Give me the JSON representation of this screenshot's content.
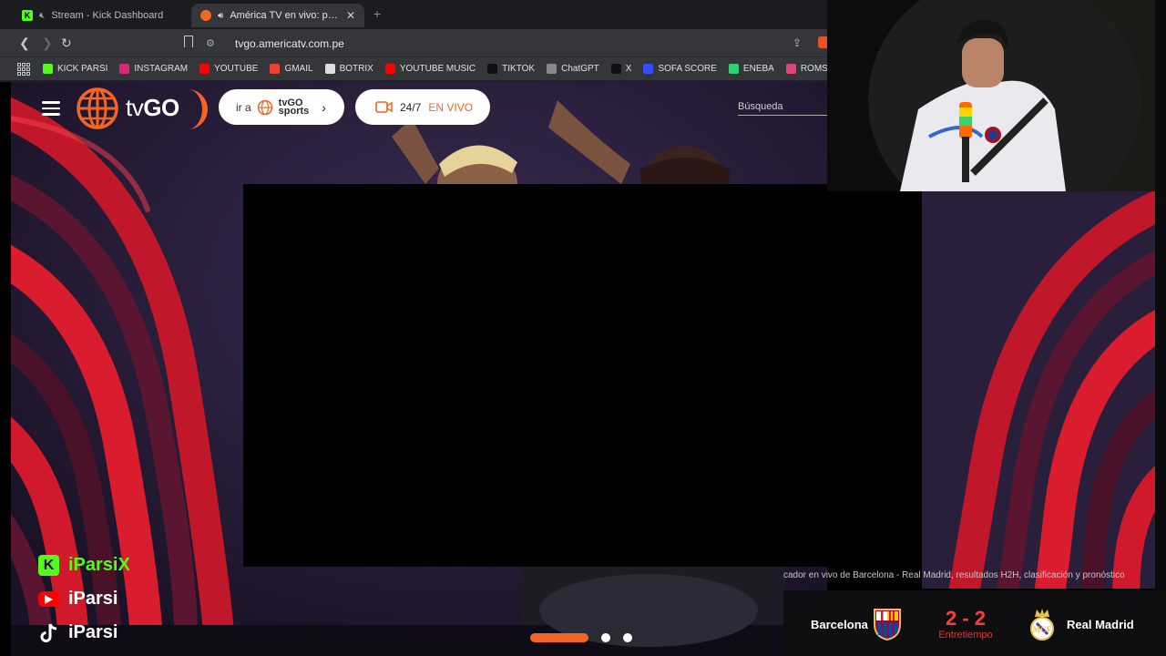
{
  "browser": {
    "tabs": [
      {
        "title": "Stream - Kick Dashboard",
        "favicon": "kick-icon",
        "muted": true,
        "active": false
      },
      {
        "title": "América TV en vivo: program",
        "favicon": "americatv-icon",
        "audio": true,
        "active": true
      }
    ],
    "close_glyph": "✕",
    "new_tab_glyph": "+",
    "url": "tvgo.americatv.com.pe",
    "bookmarks": [
      {
        "label": "KICK PARSI",
        "icon": "kick-icon",
        "color": "#53fc18"
      },
      {
        "label": "INSTAGRAM",
        "icon": "instagram-icon",
        "color": "#d62976"
      },
      {
        "label": "YOUTUBE",
        "icon": "youtube-icon",
        "color": "#ff0000"
      },
      {
        "label": "GMAIL",
        "icon": "gmail-icon",
        "color": "#ea4335"
      },
      {
        "label": "BOTRIX",
        "icon": "botrix-icon",
        "color": "#dddddd"
      },
      {
        "label": "YOUTUBE MUSIC",
        "icon": "youtube-music-icon",
        "color": "#ff0000"
      },
      {
        "label": "TIKTOK",
        "icon": "tiktok-icon",
        "color": "#111111"
      },
      {
        "label": "ChatGPT",
        "icon": "chatgpt-icon",
        "color": "#888888"
      },
      {
        "label": "X",
        "icon": "x-icon",
        "color": "#111111"
      },
      {
        "label": "SOFA SCORE",
        "icon": "sofascore-icon",
        "color": "#374df5"
      },
      {
        "label": "ENEBA",
        "icon": "eneba-icon",
        "color": "#2fd07a"
      },
      {
        "label": "ROMSFUN",
        "icon": "romsfun-icon",
        "color": "#e0447b"
      }
    ]
  },
  "site": {
    "logo": {
      "prefix": "tv",
      "suffix": "GO"
    },
    "sports_pill": {
      "prefix": "ir a",
      "logo_top": "tvGO",
      "logo_bottom": "sports"
    },
    "live_pill": {
      "part1": "24/7",
      "part2": "EN VIVO"
    },
    "search_placeholder": "Búsqueda",
    "carousel": {
      "slides": 3,
      "active": 0
    }
  },
  "overlay": {
    "socials": [
      {
        "platform": "kick",
        "handle": "iParsiX",
        "icon": "kick-icon"
      },
      {
        "platform": "youtube",
        "handle": "iParsi",
        "icon": "youtube-icon"
      },
      {
        "platform": "tiktok",
        "handle": "iParsi",
        "icon": "tiktok-icon"
      }
    ],
    "headline": "cador en vivo de Barcelona - Real Madrid, resultados H2H, clasificación y pronóstico",
    "scoreboard": {
      "home": "Barcelona",
      "away": "Real Madrid",
      "score": "2 - 2",
      "period": "Entretiempo"
    }
  },
  "colors": {
    "brand_orange": "#f26522",
    "kick_green": "#53fc18",
    "score_red": "#ff3b3b"
  }
}
